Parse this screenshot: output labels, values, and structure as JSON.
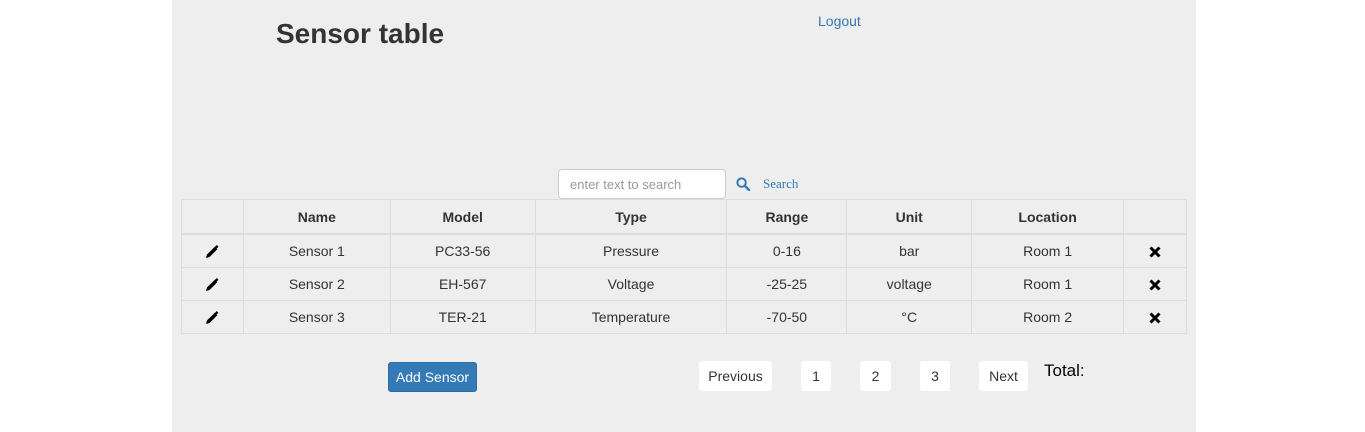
{
  "header": {
    "title": "Sensor table",
    "logout_label": "Logout"
  },
  "search": {
    "placeholder": "enter text to search",
    "value": "",
    "button_label": "Search",
    "icon": "search-icon"
  },
  "table": {
    "columns": [
      "",
      "Name",
      "Model",
      "Type",
      "Range",
      "Unit",
      "Location",
      ""
    ],
    "rows": [
      {
        "name": "Sensor 1",
        "model": "PC33-56",
        "type": "Pressure",
        "range": "0-16",
        "unit": "bar",
        "location": "Room 1"
      },
      {
        "name": "Sensor 2",
        "model": "EH-567",
        "type": "Voltage",
        "range": "-25-25",
        "unit": "voltage",
        "location": "Room 1"
      },
      {
        "name": "Sensor 3",
        "model": "TER-21",
        "type": "Temperature",
        "range": "-70-50",
        "unit": "°C",
        "location": "Room 2"
      }
    ],
    "edit_icon": "pencil-icon",
    "delete_icon": "close-icon"
  },
  "actions": {
    "add_label": "Add Sensor"
  },
  "pagination": {
    "previous_label": "Previous",
    "pages": [
      "1",
      "2",
      "3"
    ],
    "next_label": "Next",
    "total_label": "Total:"
  },
  "colors": {
    "page_background": "#eeeeee",
    "link": "#337ab7",
    "primary_button": "#337ab7"
  }
}
